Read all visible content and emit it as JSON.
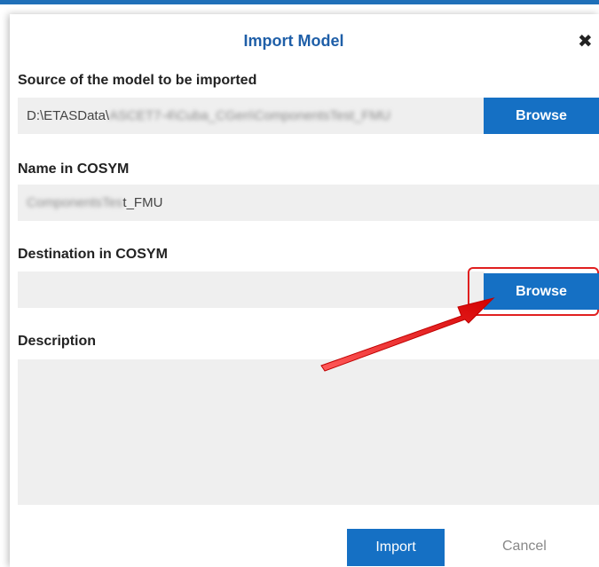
{
  "dialog": {
    "title": "Import Model",
    "close_glyph": "✖"
  },
  "source": {
    "label": "Source of the model to be imported",
    "value_prefix": "D:\\ETASData\\",
    "value_blurred": "ASCET7-4\\Cuba_CGen\\ComponentsTest_FMU",
    "browse_label": "Browse"
  },
  "name": {
    "label": "Name in COSYM",
    "value_blurred": "ComponentsTes",
    "value_suffix": "t_FMU"
  },
  "destination": {
    "label": "Destination in COSYM",
    "value": "",
    "browse_label": "Browse"
  },
  "description": {
    "label": "Description",
    "value": ""
  },
  "footer": {
    "import_label": "Import",
    "cancel_label": "Cancel"
  },
  "colors": {
    "accent": "#1570c4",
    "highlight": "#e02020",
    "field_bg": "#efefef"
  }
}
